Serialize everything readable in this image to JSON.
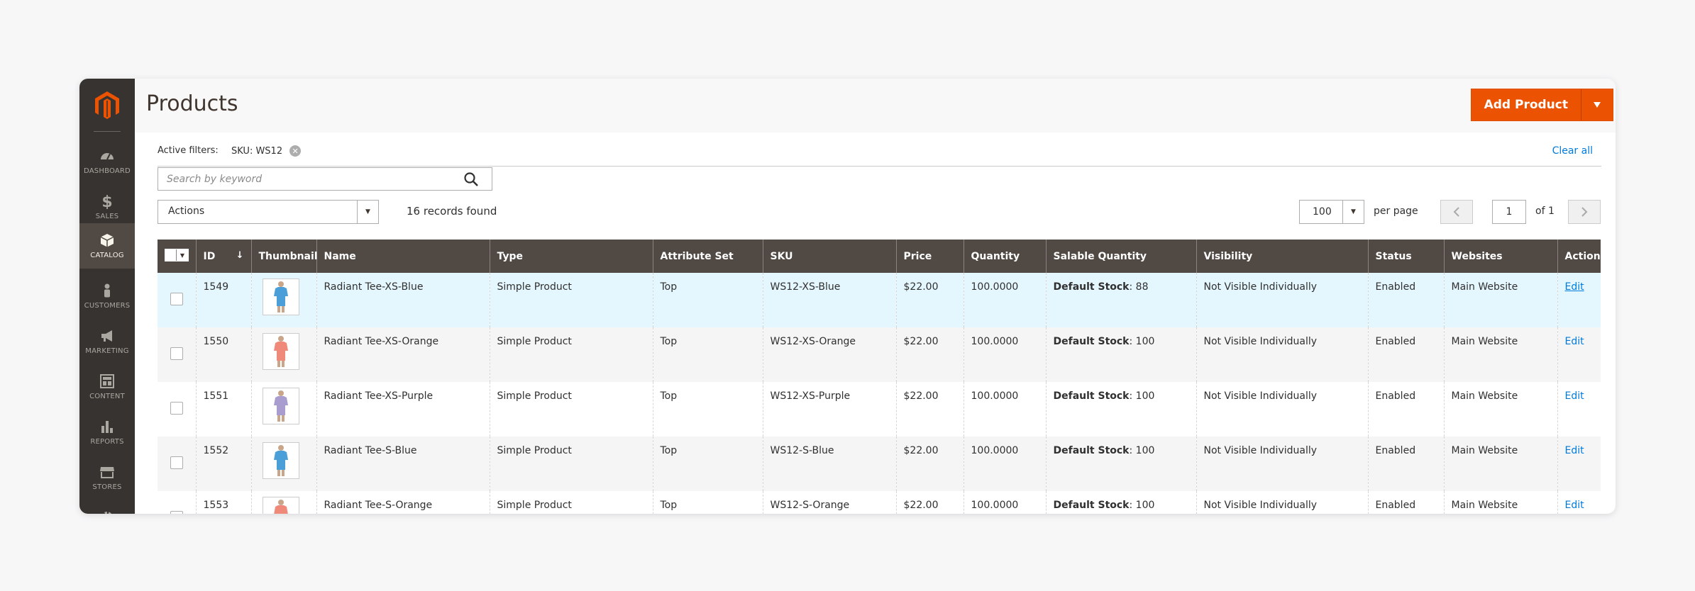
{
  "sidebar": {
    "items": [
      {
        "label": "DASHBOARD",
        "icon": "dashboard-icon",
        "active": false
      },
      {
        "label": "SALES",
        "icon": "dollar-icon",
        "active": false
      },
      {
        "label": "CATALOG",
        "icon": "box-icon",
        "active": true
      },
      {
        "label": "CUSTOMERS",
        "icon": "person-icon",
        "active": false
      },
      {
        "label": "MARKETING",
        "icon": "megaphone-icon",
        "active": false
      },
      {
        "label": "CONTENT",
        "icon": "layout-icon",
        "active": false
      },
      {
        "label": "REPORTS",
        "icon": "bar-chart-icon",
        "active": false
      },
      {
        "label": "STORES",
        "icon": "storefront-icon",
        "active": false
      }
    ]
  },
  "header": {
    "title": "Products",
    "add_button": "Add Product"
  },
  "filters": {
    "label": "Active filters:",
    "chip": "SKU: WS12",
    "clear_all": "Clear all"
  },
  "search": {
    "placeholder": "Search by keyword"
  },
  "toolbar": {
    "actions_label": "Actions",
    "records": "16 records found",
    "per_page_value": "100",
    "per_page_label": "per page",
    "page_value": "1",
    "page_of": "of 1"
  },
  "colors": {
    "accent": "#eb5202",
    "sidebar": "#373330",
    "header_row": "#514943",
    "link": "#007bdb"
  },
  "table": {
    "columns": [
      "ID",
      "Thumbnail",
      "Name",
      "Type",
      "Attribute Set",
      "SKU",
      "Price",
      "Quantity",
      "Salable Quantity",
      "Visibility",
      "Status",
      "Websites",
      "Action"
    ],
    "rows": [
      {
        "id": "1549",
        "name": "Radiant Tee-XS-Blue",
        "type": "Simple Product",
        "attr": "Top",
        "sku": "WS12-XS-Blue",
        "price": "$22.00",
        "qty": "100.0000",
        "stock_label": "Default Stock",
        "stock_value": ": 88",
        "visibility": "Not Visible Individually",
        "status": "Enabled",
        "website": "Main Website",
        "action": "Edit",
        "shirt": "#4a9fd8"
      },
      {
        "id": "1550",
        "name": "Radiant Tee-XS-Orange",
        "type": "Simple Product",
        "attr": "Top",
        "sku": "WS12-XS-Orange",
        "price": "$22.00",
        "qty": "100.0000",
        "stock_label": "Default Stock",
        "stock_value": ": 100",
        "visibility": "Not Visible Individually",
        "status": "Enabled",
        "website": "Main Website",
        "action": "Edit",
        "shirt": "#ef8a7a"
      },
      {
        "id": "1551",
        "name": "Radiant Tee-XS-Purple",
        "type": "Simple Product",
        "attr": "Top",
        "sku": "WS12-XS-Purple",
        "price": "$22.00",
        "qty": "100.0000",
        "stock_label": "Default Stock",
        "stock_value": ": 100",
        "visibility": "Not Visible Individually",
        "status": "Enabled",
        "website": "Main Website",
        "action": "Edit",
        "shirt": "#a99ccf"
      },
      {
        "id": "1552",
        "name": "Radiant Tee-S-Blue",
        "type": "Simple Product",
        "attr": "Top",
        "sku": "WS12-S-Blue",
        "price": "$22.00",
        "qty": "100.0000",
        "stock_label": "Default Stock",
        "stock_value": ": 100",
        "visibility": "Not Visible Individually",
        "status": "Enabled",
        "website": "Main Website",
        "action": "Edit",
        "shirt": "#4a9fd8"
      },
      {
        "id": "1553",
        "name": "Radiant Tee-S-Orange",
        "type": "Simple Product",
        "attr": "Top",
        "sku": "WS12-S-Orange",
        "price": "$22.00",
        "qty": "100.0000",
        "stock_label": "Default Stock",
        "stock_value": ": 100",
        "visibility": "Not Visible Individually",
        "status": "Enabled",
        "website": "Main Website",
        "action": "Edit",
        "shirt": "#ef8a7a"
      }
    ]
  }
}
